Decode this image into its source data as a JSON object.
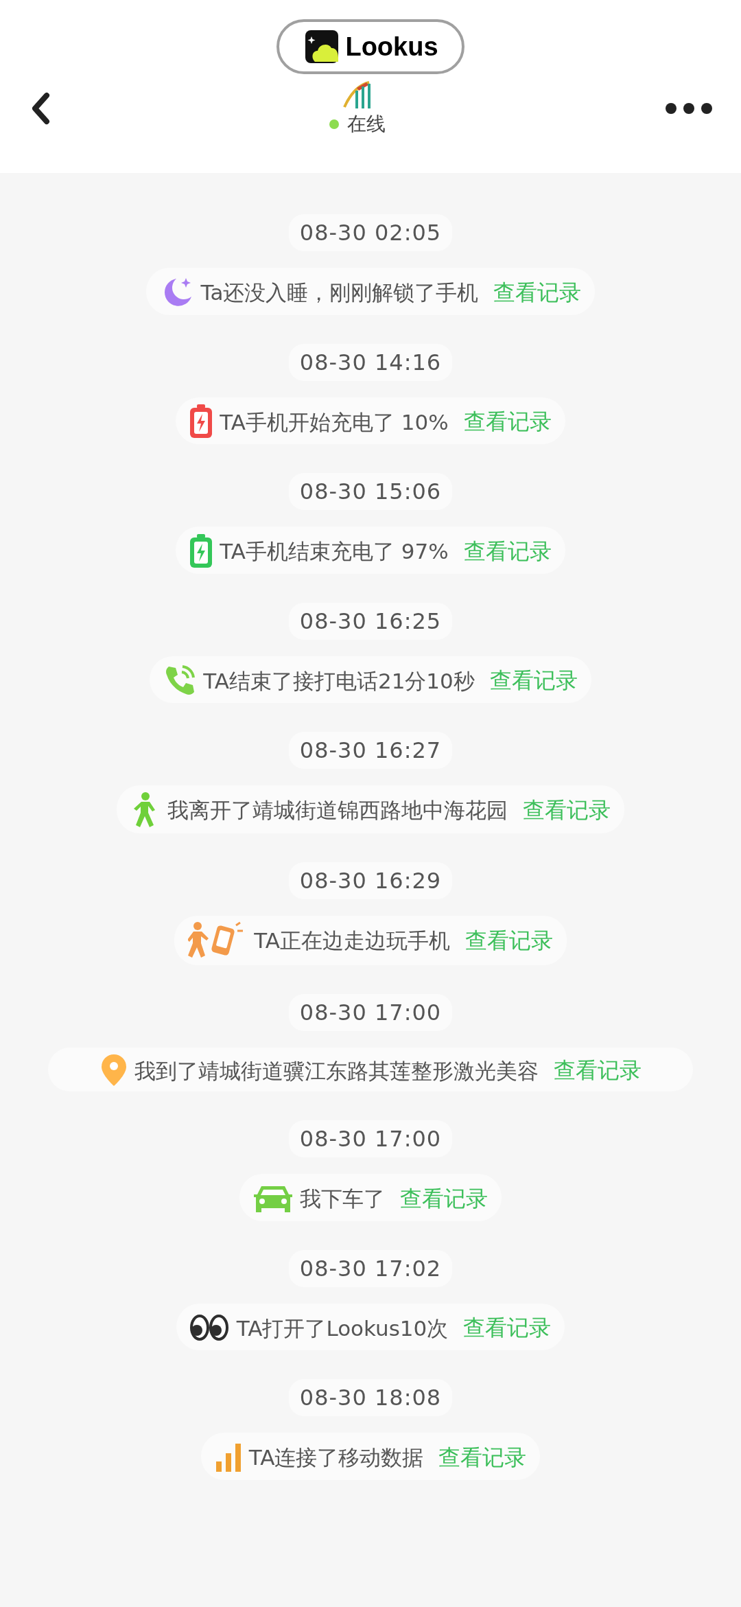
{
  "header": {
    "badge": {
      "name": "Lookus"
    },
    "status": {
      "label": "在线",
      "online": true
    }
  },
  "events": [
    {
      "time": "08-30 02:05",
      "kind": "sleep",
      "text": "Ta还没入睡，刚刚解锁了手机",
      "link": "查看记录"
    },
    {
      "time": "08-30 14:16",
      "kind": "charge_start",
      "text": "TA手机开始充电了 10%",
      "link": "查看记录"
    },
    {
      "time": "08-30 15:06",
      "kind": "charge_end",
      "text": "TA手机结束充电了 97%",
      "link": "查看记录"
    },
    {
      "time": "08-30 16:25",
      "kind": "call",
      "text": "TA结束了接打电话21分10秒",
      "link": "查看记录"
    },
    {
      "time": "08-30 16:27",
      "kind": "walk",
      "text": "我离开了靖城街道锦西路地中海花园",
      "link": "查看记录"
    },
    {
      "time": "08-30 16:29",
      "kind": "walk_phone",
      "text": "TA正在边走边玩手机",
      "link": "查看记录"
    },
    {
      "time": "08-30 17:00",
      "kind": "location",
      "text": "我到了靖城街道骥江东路其莲整形激光美容",
      "link": "查看记录"
    },
    {
      "time": "08-30 17:00",
      "kind": "car",
      "text": "我下车了",
      "link": "查看记录"
    },
    {
      "time": "08-30 17:02",
      "kind": "eyes",
      "text": "TA打开了Lookus10次",
      "link": "查看记录"
    },
    {
      "time": "08-30 18:08",
      "kind": "cellular",
      "text": "TA连接了移动数据",
      "link": "查看记录"
    }
  ]
}
